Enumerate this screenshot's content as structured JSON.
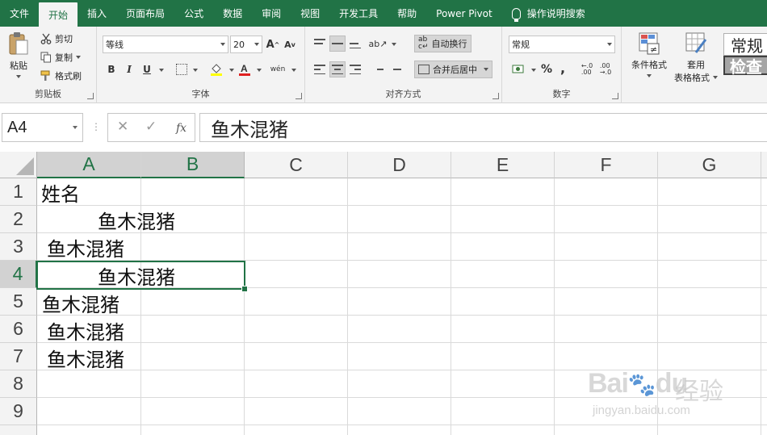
{
  "menu": {
    "tabs": [
      "文件",
      "开始",
      "插入",
      "页面布局",
      "公式",
      "数据",
      "审阅",
      "视图",
      "开发工具",
      "帮助",
      "Power Pivot"
    ],
    "active_tab": "开始",
    "search_label": "操作说明搜索"
  },
  "ribbon": {
    "clipboard": {
      "paste": "粘贴",
      "cut": "剪切",
      "copy": "复制",
      "format_painter": "格式刷",
      "label": "剪贴板"
    },
    "font": {
      "name": "等线",
      "size": "20",
      "bold": "B",
      "italic": "I",
      "underline": "U",
      "label": "字体",
      "grow": "A",
      "shrink": "A",
      "phonetic": "wén"
    },
    "alignment": {
      "wrap_text": "自动换行",
      "merge_center": "合并后居中",
      "label": "对齐方式"
    },
    "number": {
      "format": "常规",
      "percent": "%",
      "comma": ",",
      "label": "数字"
    },
    "styles": {
      "conditional": "条件格式",
      "table_format_1": "套用",
      "table_format_2": "表格格式",
      "style_normal": "常规",
      "style_check": "检查"
    }
  },
  "formula_bar": {
    "name_box": "A4",
    "fx_label": "fx",
    "content": "鱼木混猪"
  },
  "sheet": {
    "columns": [
      "A",
      "B",
      "C",
      "D",
      "E",
      "F",
      "G"
    ],
    "rows": [
      "1",
      "2",
      "3",
      "4",
      "5",
      "6",
      "7",
      "8",
      "9"
    ],
    "cells": {
      "A1": "姓名",
      "A2": "鱼木混猪",
      "A3": "鱼木混猪",
      "A4": "鱼木混猪",
      "A5": "鱼木混猪",
      "A6": "鱼木混猪",
      "A7": "鱼木混猪"
    },
    "selected_cell": "A4"
  },
  "watermark": {
    "brand": "Bai",
    "brand2": "du",
    "cn": "经验",
    "url": "jingyan.baidu.com"
  }
}
